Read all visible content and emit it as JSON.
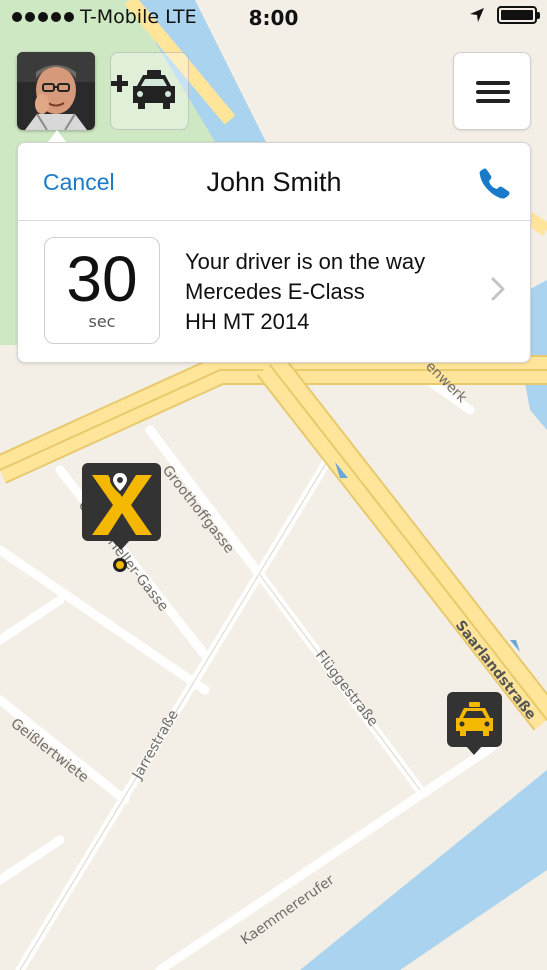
{
  "status_bar": {
    "carrier": "T-Mobile LTE",
    "time": "8:00"
  },
  "header": {
    "avatar_alt": "Driver photo"
  },
  "card": {
    "cancel_label": "Cancel",
    "driver_name": "John Smith",
    "eta_value": "30",
    "eta_unit": "sec",
    "status_line": "Your driver is on the way",
    "car_model": "Mercedes E-Class",
    "plate": "HH MT 2014"
  },
  "map": {
    "streets": [
      "Groothoffgasse",
      "Georg-Heller-Gasse",
      "Flüggestraße",
      "Saarlandstraße",
      "Jarrestraße",
      "Geißlertwiete",
      "Kaemmererufer",
      "enwerk"
    ]
  },
  "icons": {
    "location": "location-arrow-icon",
    "battery": "battery-icon",
    "add_taxi": "add-taxi-icon",
    "menu": "menu-icon",
    "phone": "phone-icon",
    "chevron": "chevron-right-icon",
    "pickup": "pickup-pin-icon",
    "taxi": "taxi-icon"
  },
  "colors": {
    "accent": "#1a7ac9",
    "brand_yellow": "#f5b800",
    "marker_dark": "#333333"
  }
}
